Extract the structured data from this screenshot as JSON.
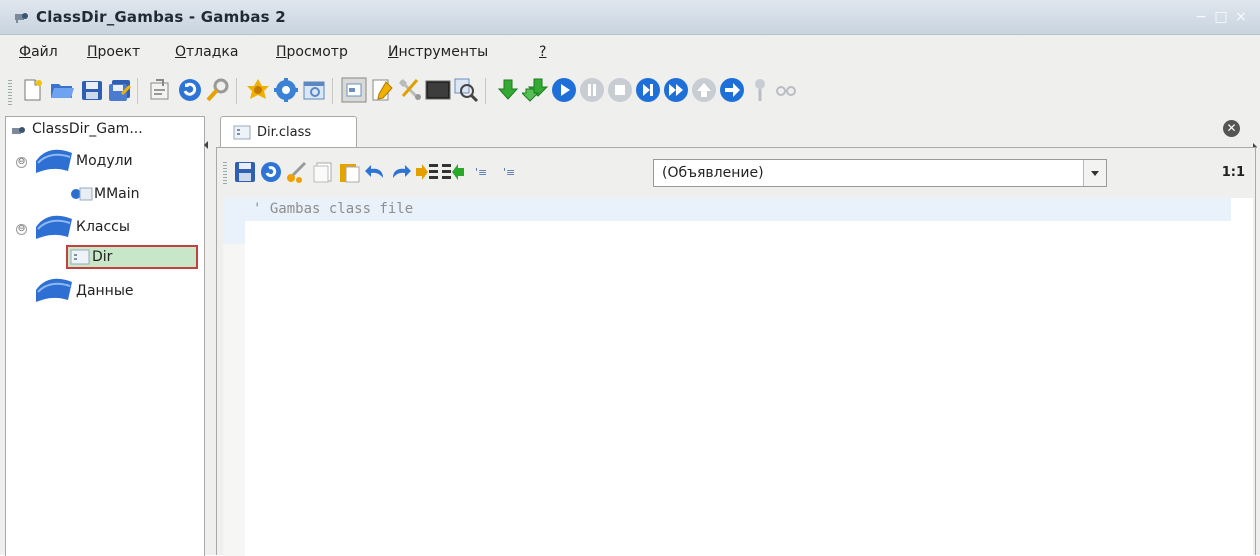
{
  "window": {
    "title": "ClassDir_Gambas - Gambas 2",
    "controls": [
      "minimize-icon",
      "maximize-icon",
      "close-icon"
    ]
  },
  "menu": {
    "items": [
      {
        "pre": "",
        "u": "Ф",
        "rest": "айл"
      },
      {
        "pre": "",
        "u": "П",
        "rest": "роект"
      },
      {
        "pre": "",
        "u": "О",
        "rest": "тладка"
      },
      {
        "pre": "",
        "u": "П",
        "rest": "росмотр"
      },
      {
        "pre": "",
        "u": "И",
        "rest": "нструменты"
      },
      {
        "pre": "",
        "u": "?",
        "rest": ""
      }
    ]
  },
  "toolbar": {
    "icons": [
      "new-file-icon",
      "open-folder-icon",
      "save-icon",
      "save-all-icon",
      "properties-icon",
      "refresh-icon",
      "search-icon",
      "make-icon",
      "settings-icon",
      "window-icon",
      "form-icon",
      "edit-icon",
      "tools-icon",
      "console-icon",
      "zoom-icon",
      "step-down-icon",
      "step-down-alt-icon",
      "run-icon",
      "pause-icon",
      "stop-icon",
      "step-icon",
      "forward-icon",
      "up-icon",
      "return-icon",
      "pin-icon",
      "glasses-icon"
    ]
  },
  "project_tree": {
    "root": "ClassDir_Gam...",
    "nodes": [
      {
        "label": "Модули",
        "toggle": "⊖"
      },
      {
        "label": "MMain",
        "toggle": ""
      },
      {
        "label": "Классы",
        "toggle": "⊖"
      },
      {
        "label": "Dir",
        "toggle": ""
      },
      {
        "label": "Данные",
        "toggle": ""
      }
    ],
    "selected": "Dir"
  },
  "editor": {
    "tab_label": "Dir.class",
    "procedure_combo": "(Объявление)",
    "cursor_pos": "1:1",
    "code_lines": [
      "' Gambas class file"
    ],
    "icons": [
      "save-icon",
      "refresh-icon",
      "cut-icon",
      "copy-icon",
      "paste-icon",
      "undo-icon",
      "redo-icon",
      "indent-icon",
      "unindent-icon",
      "comment-icon",
      "uncomment-icon"
    ]
  },
  "colors": {
    "selection_fill": "#c8e6c8",
    "selection_border": "#c24040",
    "current_line": "#e9f1fb"
  }
}
